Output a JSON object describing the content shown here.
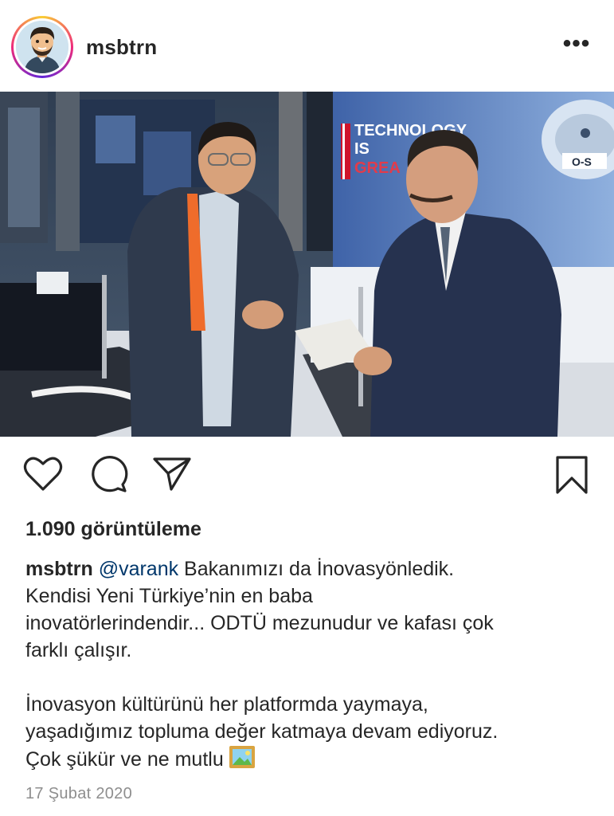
{
  "header": {
    "username": "msbtrn",
    "more_label": "•••"
  },
  "media": {
    "banner_line1": "TECHNOLOGY",
    "banner_line2": "IS",
    "banner_line3": "GREA",
    "sign_os": "O-S",
    "is_muted": true
  },
  "actions": {
    "like_icon": "heart-icon",
    "comment_icon": "comment-icon",
    "share_icon": "paper-plane-icon",
    "save_icon": "bookmark-icon"
  },
  "views": "1.090 görüntüleme",
  "caption": {
    "username": "msbtrn",
    "mention": "@varank",
    "line1_rest": " Bakanımızı da İnovasyönledik.",
    "line2": "Kendisi Yeni Türkiye’nin en baba",
    "line3": "inovatörlerindendir... ODTÜ mezunudur ve kafası çok",
    "line4": "farklı çalışır.",
    "para2_line1": "İnovasyon kültürünü her platformda yaymaya,",
    "para2_line2": "yaşadığımız topluma değer katmaya devam ediyoruz.",
    "para2_line3": "Çok şükür ve ne mutlu",
    "emoji": "framed-picture-emoji"
  },
  "date": "17 Şubat 2020",
  "colors": {
    "text": "#262626",
    "mention": "#00376b",
    "date": "#8e8e8e"
  }
}
